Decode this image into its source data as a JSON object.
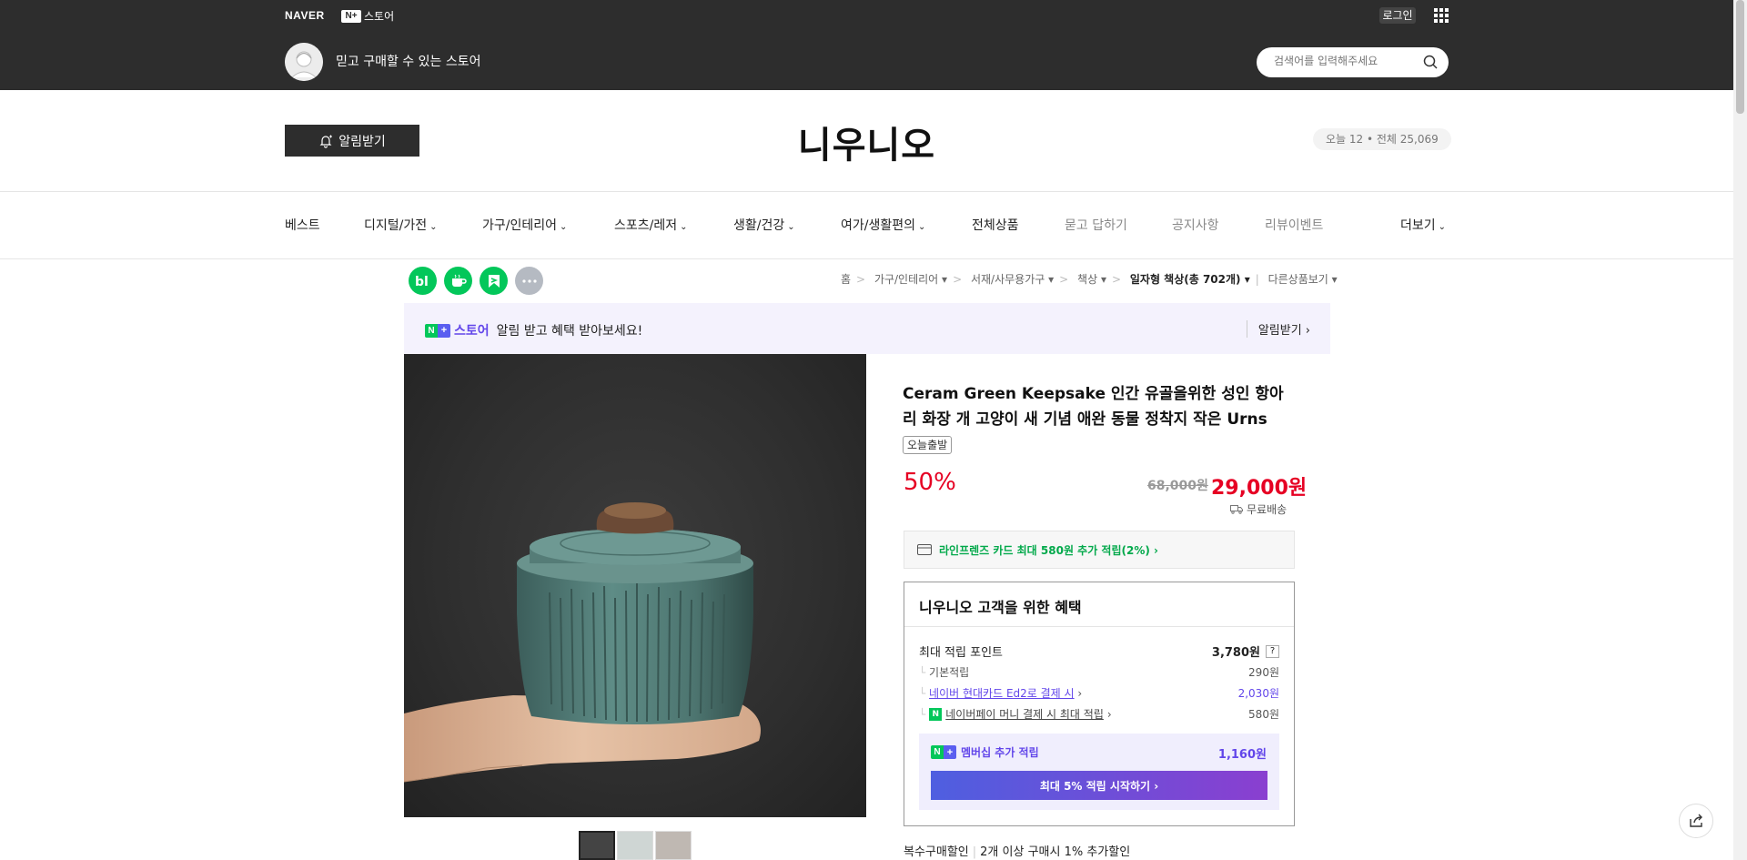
{
  "topbar": {
    "naver": "NAVER",
    "nplus_badge": "N+",
    "nplus_store": "스토어",
    "login": "로그인",
    "tagline": "믿고 구매할 수 있는 스토어",
    "search_placeholder": "검색어를 입력해주세요"
  },
  "store": {
    "alarm_btn": "알림받기",
    "name": "니우니오",
    "visitors": "오늘 12 • 전체 25,069"
  },
  "nav": {
    "items": [
      "베스트",
      "디지털/가전",
      "가구/인테리어",
      "스포츠/레저",
      "생활/건강",
      "여가/생활편의",
      "전체상품",
      "묻고 답하기",
      "공지사항",
      "리뷰이벤트",
      "더보기"
    ]
  },
  "breadcrumb": {
    "home": "홈",
    "c1": "가구/인테리어",
    "c2": "서재/사무용가구",
    "c3": "책상",
    "c4": "일자형 책상(총 702개)",
    "other": "다른상품보기"
  },
  "banner": {
    "store": "스토어",
    "text": "알림 받고 혜택 받아보세요!",
    "link": "알림받기"
  },
  "product": {
    "title": "Ceram Green Keepsake 인간 유골을위한 성인 항아리 화장 개 고양이 새 기념 애완 동물 정착지 작은 Urns",
    "badge": "오늘출발",
    "discount": "50%",
    "original_price": "68,000원",
    "price": "29,000원",
    "shipping": "무료배송",
    "card_promo": "라인프렌즈 카드 최대 580원 추가 적립(2%)"
  },
  "benefit": {
    "title": "니우니오 고객을 위한 혜택",
    "max_label": "최대 적립 포인트",
    "max_val": "3,780원",
    "help": "?",
    "rows": [
      {
        "label": "기본적립",
        "val": "290원"
      },
      {
        "label": "네이버 현대카드 Ed2로 결제 시",
        "val": "2,030원"
      },
      {
        "label": "네이버페이 머니 결제 시 최대 적립",
        "val": "580원"
      }
    ],
    "member_label": "멤버십 추가 적립",
    "member_val": "1,160원",
    "member_btn": "최대 5% 적립 시작하기"
  },
  "multi": {
    "label": "복수구매할인",
    "text": "2개 이상 구매시 1% 추가할인"
  }
}
